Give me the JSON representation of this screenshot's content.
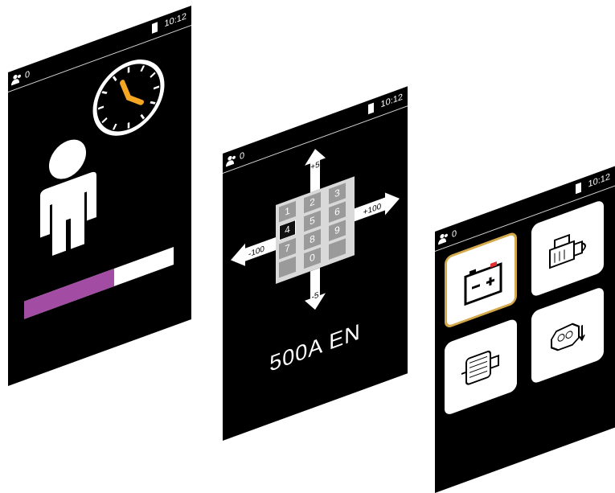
{
  "screens": [
    {
      "status": {
        "user_count": "0",
        "time": "10:12"
      },
      "progress": 0.6,
      "colors": {
        "progress_fill": "#a34ca3",
        "clock_hands": "#f5a623"
      },
      "icons": [
        "user-icon",
        "clock-icon",
        "person-icon",
        "battery-icon"
      ]
    },
    {
      "status": {
        "user_count": "0",
        "time": "10:12"
      },
      "arrows": {
        "up": "+5",
        "down": "-5",
        "left": "-100",
        "right": "+100"
      },
      "keys": [
        "1",
        "2",
        "3",
        "4",
        "5",
        "6",
        "7",
        "8",
        "9",
        "0"
      ],
      "active_key": "4",
      "label": "500A EN"
    },
    {
      "status": {
        "user_count": "0",
        "time": "10:12"
      },
      "tiles": [
        {
          "icon": "battery-test-icon",
          "selected": true
        },
        {
          "icon": "starter-motor-icon",
          "selected": false
        },
        {
          "icon": "alternator-icon",
          "selected": false
        },
        {
          "icon": "engine-icon",
          "selected": false
        }
      ],
      "colors": {
        "selected_border": "#d4a94b"
      }
    }
  ]
}
